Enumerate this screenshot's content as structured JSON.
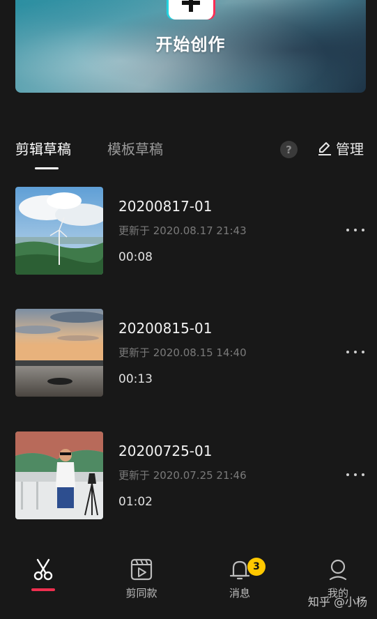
{
  "banner": {
    "title": "开始创作"
  },
  "tabs": [
    {
      "label": "剪辑草稿",
      "active": true
    },
    {
      "label": "模板草稿",
      "active": false
    }
  ],
  "header_actions": {
    "help": "?",
    "manage_label": "管理"
  },
  "drafts": [
    {
      "title": "20200817-01",
      "updated": "更新于 2020.08.17 21:43",
      "duration": "00:08",
      "thumb": "wind-turbine-landscape"
    },
    {
      "title": "20200815-01",
      "updated": "更新于 2020.08.15 14:40",
      "duration": "00:13",
      "thumb": "sunset-lake"
    },
    {
      "title": "20200725-01",
      "updated": "更新于 2020.07.25 21:46",
      "duration": "01:02",
      "thumb": "person-at-viewpoint"
    }
  ],
  "bottom_nav": [
    {
      "label": "",
      "icon": "scissors-icon",
      "active": true
    },
    {
      "label": "剪同款",
      "icon": "clapper-icon",
      "active": false
    },
    {
      "label": "消息",
      "icon": "bell-icon",
      "active": false,
      "badge": "3"
    },
    {
      "label": "我的",
      "icon": "profile-icon",
      "active": false
    }
  ],
  "watermark": "知乎 @小杨",
  "colors": {
    "background": "#181818",
    "accent": "#ee2f4f",
    "badge": "#ffc800"
  }
}
